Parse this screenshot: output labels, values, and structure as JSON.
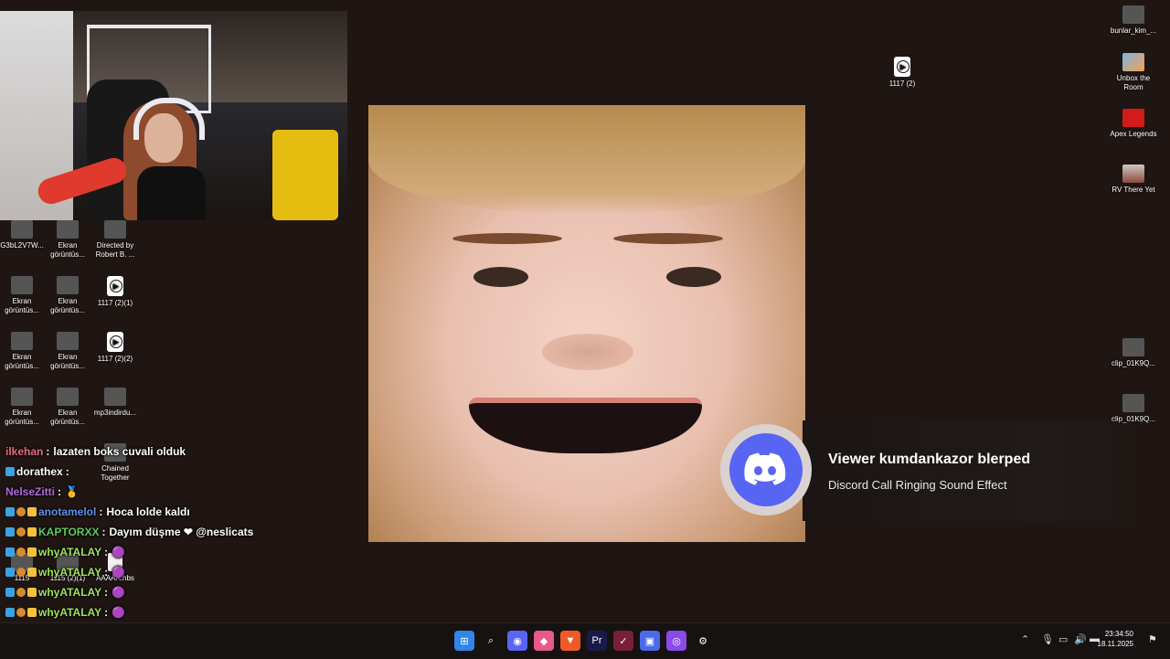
{
  "desktop": {
    "left_icons": [
      {
        "label": "G3bL2V7W...",
        "kind": "img"
      },
      {
        "label": "Ekran görüntüs...",
        "kind": "img"
      },
      {
        "label": "Directed by Robert B. ...",
        "kind": "img"
      },
      {
        "label": "Ekran görüntüs...",
        "kind": "img"
      },
      {
        "label": "Ekran görüntüs...",
        "kind": "img"
      },
      {
        "label": "1117 (2)(1)",
        "kind": "play"
      },
      {
        "label": "Ekran görüntüs...",
        "kind": "img"
      },
      {
        "label": "Ekran görüntüs...",
        "kind": "img"
      },
      {
        "label": "1117 (2)(2)",
        "kind": "play"
      },
      {
        "label": "Ekran görüntüs...",
        "kind": "img"
      },
      {
        "label": "Ekran görüntüs...",
        "kind": "img"
      },
      {
        "label": "mp3indirdu...",
        "kind": "img"
      },
      {
        "label": "Chained Together",
        "kind": "img"
      },
      {
        "label": "1115",
        "kind": "img"
      },
      {
        "label": "1115 (2)(1)",
        "kind": "img"
      },
      {
        "label": "AAAAA.hbs",
        "kind": "file"
      }
    ],
    "right_icons": [
      {
        "label": "bunlar_kim_...",
        "kind": "img"
      },
      {
        "label": "Unbox the Room",
        "kind": "app"
      },
      {
        "label": "Apex Legends",
        "kind": "red"
      },
      {
        "label": "RV There Yet",
        "kind": "game"
      },
      {
        "label": "clip_01K9Q...",
        "kind": "img"
      },
      {
        "label": "clip_01K9Q...",
        "kind": "img"
      }
    ],
    "mid_icon": {
      "label": "1117 (2)",
      "kind": "play"
    }
  },
  "notification": {
    "title": "Viewer kumdankazor blerped",
    "subtitle": "Discord Call Ringing Sound Effect",
    "icon": "discord-icon",
    "accent": "#5865f2"
  },
  "chat": [
    {
      "user": "ilkehan",
      "color": "#e86a7a",
      "sep": ":",
      "msg": "lazaten boks cuvali olduk",
      "badges": 0
    },
    {
      "user": "dorathex",
      "color": "#ffffff",
      "sep": ":",
      "msg": "",
      "badges": 1
    },
    {
      "user": "NelseZitti",
      "color": "#b36ae2",
      "sep": ":",
      "msg": "🥇",
      "badges": 0
    },
    {
      "user": "anotamelol",
      "color": "#5f8fe8",
      "sep": ":",
      "msg": "Hoca lolde kaldı",
      "badges": 3
    },
    {
      "user": "KAPTORXX",
      "color": "#5ec85e",
      "sep": ":",
      "msg": "Dayım düşme  ❤  @neslicats",
      "badges": 3
    },
    {
      "user": "whyATALAY",
      "color": "#9ee35a",
      "sep": ":",
      "msg": "🟣",
      "badges": 3
    },
    {
      "user": "whyATALAY",
      "color": "#9ee35a",
      "sep": ":",
      "msg": "🟣",
      "badges": 3
    },
    {
      "user": "whyATALAY",
      "color": "#9ee35a",
      "sep": ":",
      "msg": "🟣",
      "badges": 3
    },
    {
      "user": "whyATALAY",
      "color": "#9ee35a",
      "sep": ":",
      "msg": "🟣",
      "badges": 3
    },
    {
      "user": "whyATALAY",
      "color": "#9ee35a",
      "sep": ":",
      "msg": "🟣",
      "badges": 3
    }
  ],
  "taskbar": {
    "apps": [
      {
        "name": "start-button",
        "glyph": "⊞",
        "bg": "#2f86e6"
      },
      {
        "name": "search-button",
        "glyph": "⌕",
        "bg": "transparent"
      },
      {
        "name": "discord-app",
        "glyph": "◉",
        "bg": "#5865f2"
      },
      {
        "name": "photos-app",
        "glyph": "◆",
        "bg": "#e85a8a"
      },
      {
        "name": "brave-app",
        "glyph": "▼",
        "bg": "#f05a28"
      },
      {
        "name": "premiere-app",
        "glyph": "Pr",
        "bg": "#1a1a4a"
      },
      {
        "name": "vegas-app",
        "glyph": "✓",
        "bg": "#7a1f3a"
      },
      {
        "name": "vpn-app",
        "glyph": "▣",
        "bg": "#4a6ae8"
      },
      {
        "name": "obs-like-app",
        "glyph": "◎",
        "bg": "#8a4ae8"
      },
      {
        "name": "steam-app",
        "glyph": "⚙",
        "bg": "transparent"
      }
    ],
    "time": "23:34:50",
    "date": "18.11.2025"
  }
}
